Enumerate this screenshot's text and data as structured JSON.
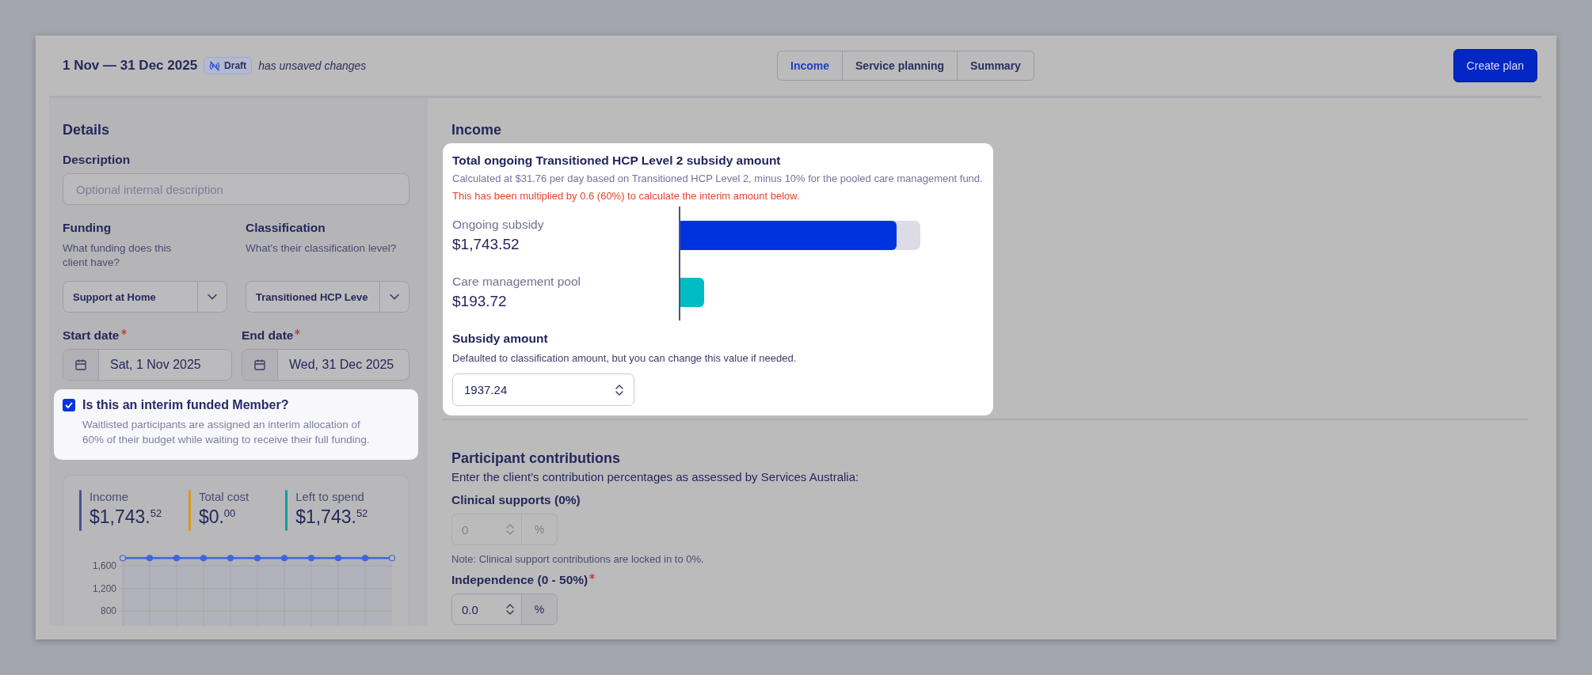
{
  "header": {
    "period": "1 Nov — 31 Dec 2025",
    "status_badge": "Draft",
    "unsaved_note": "has unsaved changes"
  },
  "tabs": [
    {
      "label": "Income",
      "selected": true
    },
    {
      "label": "Service planning",
      "selected": false
    },
    {
      "label": "Summary",
      "selected": false
    }
  ],
  "create_button": "Create plan",
  "details": {
    "title": "Details",
    "description": {
      "label": "Description",
      "placeholder": "Optional internal description"
    },
    "funding": {
      "label": "Funding",
      "help": "What funding does this client have?",
      "value": "Support at Home"
    },
    "classification": {
      "label": "Classification",
      "help": "What's their classification level?",
      "value": "Transitioned HCP Leve"
    },
    "start_date": {
      "label": "Start date",
      "required": true,
      "value": "Sat, 1 Nov 2025"
    },
    "end_date": {
      "label": "End date",
      "required": true,
      "value": "Wed, 31 Dec 2025"
    },
    "interim": {
      "label": "Is this an interim funded Member?",
      "checked": true,
      "help": "Waitlisted participants are assigned an interim allocation of 60% of their budget while waiting to receive their full funding."
    },
    "stats": [
      {
        "label": "Income",
        "value": "$1,743.$^{52}$",
        "color": "#4b4f8f"
      },
      {
        "label": "Total cost",
        "value": "$0.$^{00}$",
        "color": "#d69a1f"
      },
      {
        "label": "Left to spend",
        "value": "$1,743.$^{52}$",
        "color": "#139e9a"
      }
    ],
    "chart_data": {
      "type": "line",
      "ylim": [
        0,
        1800
      ],
      "grid": true,
      "yticks": [
        {
          "value": 800,
          "label": "800"
        },
        {
          "value": 1200,
          "label": "1,200"
        },
        {
          "value": 1600,
          "label": "1,600"
        }
      ],
      "series": [
        {
          "color": "#3f66d6",
          "marker": true,
          "values": [
            1740,
            1740,
            1740,
            1740,
            1740,
            1740,
            1740,
            1740,
            1740,
            1740,
            1740
          ]
        }
      ]
    }
  },
  "income": {
    "title": "Income",
    "card": {
      "title": "Total ongoing Transitioned HCP Level 2 subsidy amount",
      "calculation": "Calculated at $31.76 per day based on Transitioned HCP Level 2, minus 10% for the pooled care management fund.",
      "warning": "This has been multiplied by 0.6 (60%) to calculate the interim amount below.",
      "bars": [
        {
          "label": "Ongoing subsidy",
          "value": "$1,743.52",
          "level": 0.9,
          "color": "#0033e0",
          "track": true
        },
        {
          "label": "Care management pool",
          "value": "$193.72",
          "level": 0.1,
          "color": "#00bcc4",
          "track": false
        }
      ],
      "subsidy": {
        "label": "Subsidy amount",
        "help": "Defaulted to classification amount, but you can change this value if needed.",
        "value": "1937.24"
      }
    }
  },
  "contributions": {
    "title": "Participant contributions",
    "help": "Enter the client’s contribution percentages as assessed by Services Australia:",
    "fields": [
      {
        "label": "Clinical supports (0%)",
        "required": false,
        "disabled": true,
        "value": "0",
        "unit": "%",
        "note": "Note: Clinical support contributions are locked in to 0%."
      },
      {
        "label": "Independence (0 - 50%)",
        "required": true,
        "disabled": false,
        "value": "0.0",
        "unit": "%"
      }
    ]
  }
}
